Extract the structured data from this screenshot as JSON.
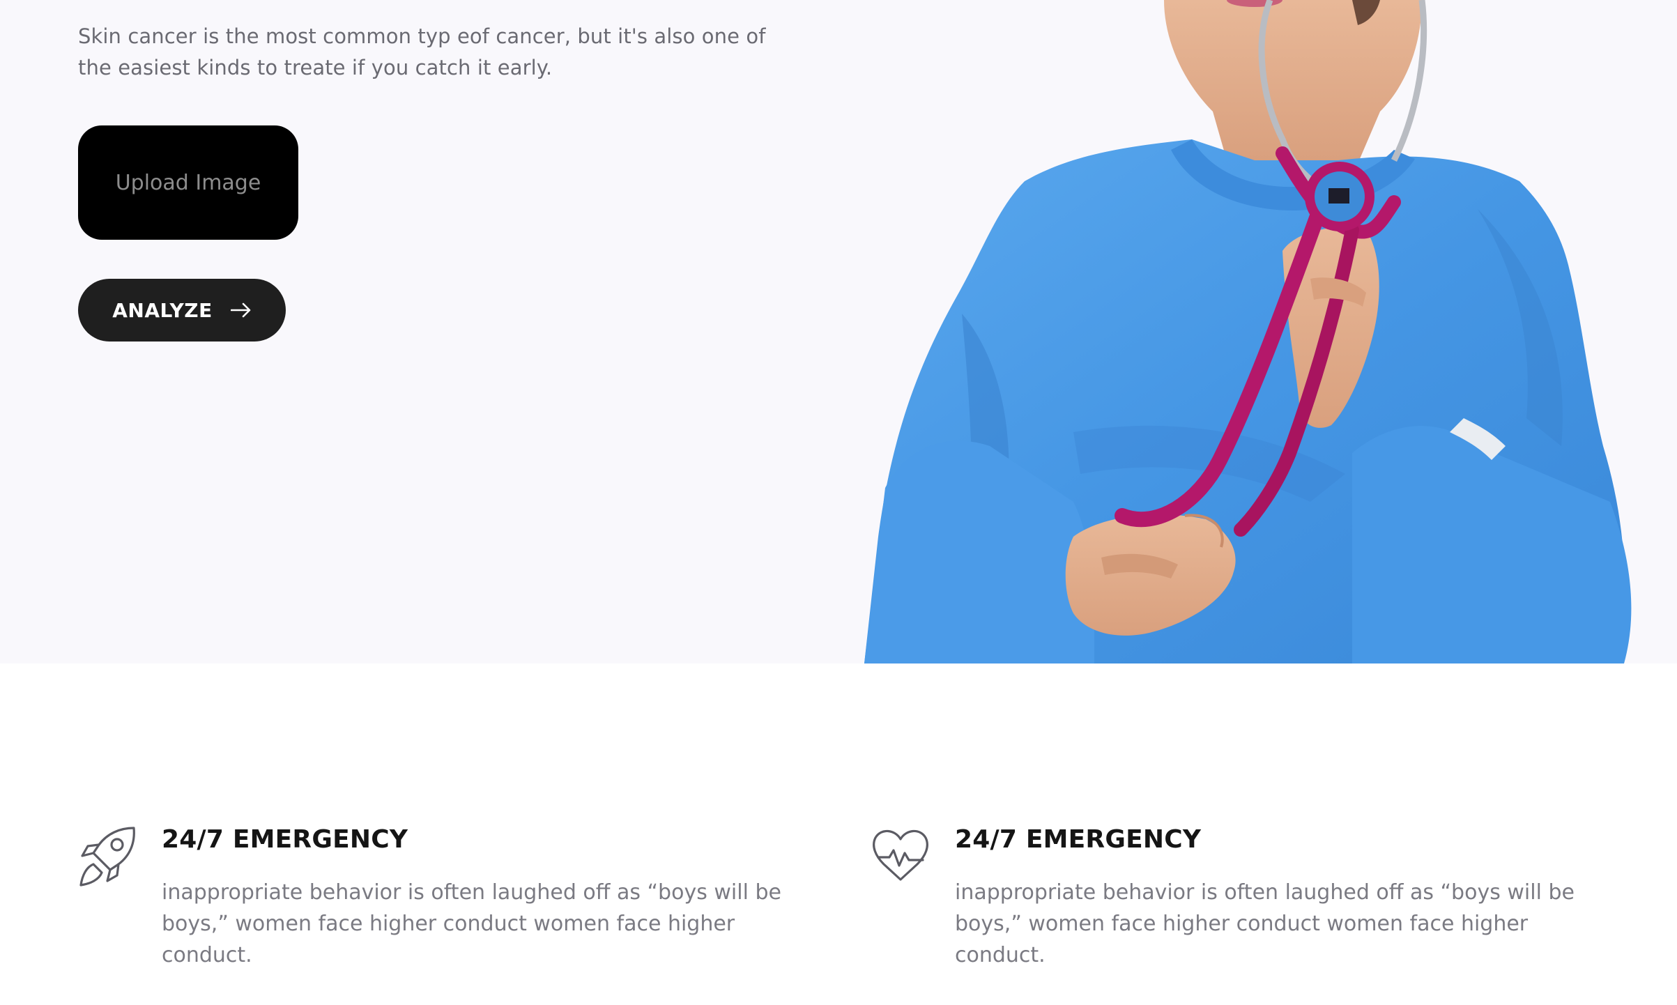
{
  "hero": {
    "description": "Skin cancer is the most common typ eof cancer, but it's also one of the easiest kinds to treate if you catch it early.",
    "upload_label": "Upload Image",
    "analyze_label": "ANALYZE",
    "analyze_icon": "arrow-right-icon",
    "image": "doctor-with-stethoscope"
  },
  "features": [
    {
      "icon": "rocket-icon",
      "title": "24/7 EMERGENCY",
      "text": "inappropriate behavior is often laughed off as “boys will be boys,” women face higher conduct women face higher conduct."
    },
    {
      "icon": "heartbeat-icon",
      "title": "24/7 EMERGENCY",
      "text": "inappropriate behavior is often laughed off as “boys will be boys,” women face higher conduct women face higher conduct."
    }
  ],
  "colors": {
    "hero_background": "#f9f8fc",
    "button_dark": "#1f1f1f",
    "gown_blue": "#4a9ce8",
    "stethoscope": "#b4186a"
  }
}
